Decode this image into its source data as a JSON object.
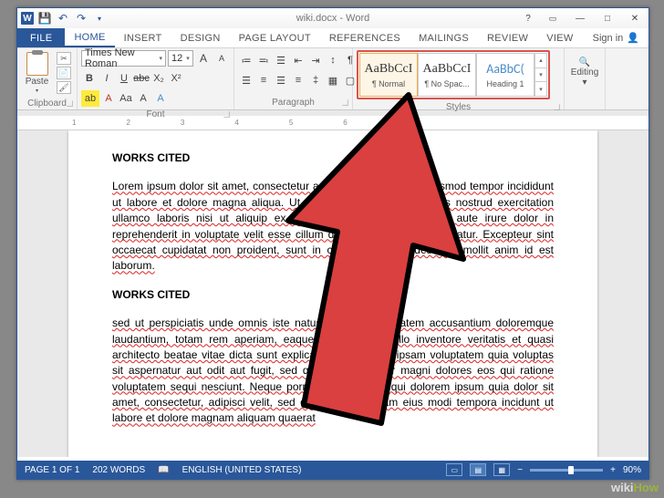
{
  "titlebar": {
    "title": "wiki.docx - Word",
    "help": "?",
    "min": "—",
    "max": "□",
    "close": "✕"
  },
  "tabs": {
    "file": "FILE",
    "home": "HOME",
    "insert": "INSERT",
    "design": "DESIGN",
    "page_layout": "PAGE LAYOUT",
    "references": "REFERENCES",
    "mailings": "MAILINGS",
    "review": "REVIEW",
    "view": "VIEW",
    "signin": "Sign in"
  },
  "ribbon": {
    "clipboard": {
      "label": "Clipboard",
      "paste": "Paste"
    },
    "font": {
      "label": "Font",
      "family": "Times New Roman",
      "size": "12",
      "b": "B",
      "i": "I",
      "u": "U",
      "abc": "abc",
      "x2": "X₂",
      "x2sup": "X²",
      "a_up": "A",
      "a_dn": "A",
      "aa": "Aa",
      "clear": "A"
    },
    "paragraph": {
      "label": "Paragraph"
    },
    "styles": {
      "label": "Styles",
      "items": [
        {
          "sample": "AaBbCcI",
          "name": "¶ Normal"
        },
        {
          "sample": "AaBbCcI",
          "name": "¶ No Spac..."
        },
        {
          "sample": "AaBbC(",
          "name": "Heading 1"
        }
      ]
    },
    "editing": {
      "label": "Editing",
      "text": "Editing"
    }
  },
  "ruler": [
    "1",
    "2",
    "3",
    "4",
    "5",
    "6",
    "7"
  ],
  "document": {
    "h1": "WORKS CITED",
    "p1": "Lorem ipsum dolor sit amet, consectetur adipisicing elit, sed do eiusmod tempor incididunt ut labore et dolore magna aliqua. Ut enim ad minim veniam, quis nostrud exercitation ullamco laboris nisi ut aliquip ex ea commodo consequat. Duis aute irure dolor in reprehenderit in voluptate velit esse cillum dolore eu fugiat nulla pariatur. Excepteur sint occaecat cupidatat non proident, sunt in culpa qui officia deserunt mollit anim id est laborum.",
    "h2": "WORKS CITED",
    "p2": "sed ut perspiciatis unde omnis iste natus error sit voluptatem accusantium doloremque laudantium, totam rem aperiam, eaque ipsa quae ab illo inventore veritatis et quasi architecto beatae vitae dicta sunt explicabo. Nemo enim ipsam voluptatem quia voluptas sit aspernatur aut odit aut fugit, sed quia consequuntur magni dolores eos qui ratione voluptatem sequi nesciunt. Neque porro quisquam est, qui dolorem ipsum quia dolor sit amet, consectetur, adipisci velit, sed quia non numquam eius modi tempora incidunt ut labore et dolore magnam aliquam quaerat"
  },
  "statusbar": {
    "page": "PAGE 1 OF 1",
    "words": "202 WORDS",
    "lang": "ENGLISH (UNITED STATES)",
    "zoom": "90%"
  },
  "watermark": {
    "pre": "wiki",
    "post": "How"
  }
}
